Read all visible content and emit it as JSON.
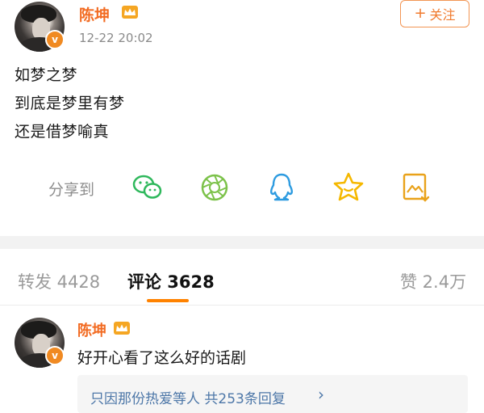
{
  "post": {
    "author": "陈坤",
    "avatar_badge": "v",
    "time": "12-22 20:02",
    "follow_label": "关注",
    "follow_icon": "plus-icon",
    "lines": [
      "如梦之梦",
      "到底是梦里有梦",
      "还是借梦喻真"
    ]
  },
  "share": {
    "label": "分享到",
    "icons": [
      "wechat-icon",
      "moments-icon",
      "qq-icon",
      "favorite-star-icon",
      "save-image-icon"
    ]
  },
  "tabs": {
    "repost": "转发 4428",
    "comment": "评论 3628",
    "like": "赞 2.4万"
  },
  "comment": {
    "author": "陈坤",
    "avatar_badge": "v",
    "text": "好开心看了这么好的话剧",
    "reply_summary": "只因那份热爱等人 共253条回复",
    "reply_chevron": "›"
  },
  "colors": {
    "accent_orange": "#ff8200",
    "name_orange": "#f26b22",
    "link_blue": "#4d77a8",
    "icon_green": "#2fb85c",
    "icon_lime": "#7cc24a",
    "icon_blue": "#2d9be0",
    "icon_yellow": "#f5b800",
    "icon_gold": "#e9a21a"
  }
}
